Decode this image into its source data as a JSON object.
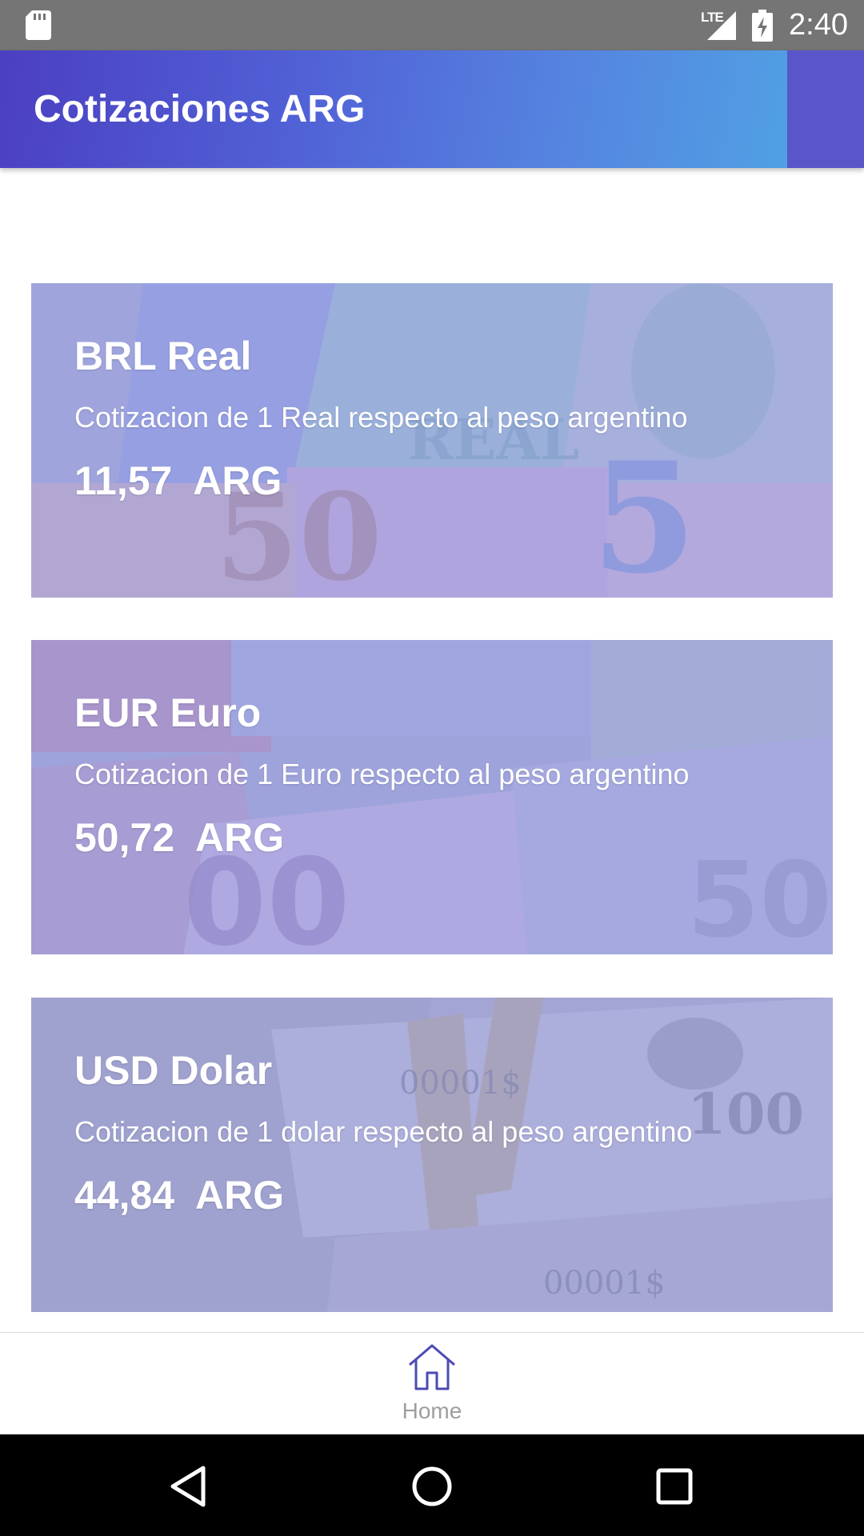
{
  "status_bar": {
    "network": "LTE",
    "time": "2:40",
    "icons": [
      "sd-card-icon",
      "signal-icon",
      "battery-charging-icon"
    ]
  },
  "app_bar": {
    "title": "Cotizaciones ARG"
  },
  "cards": [
    {
      "name": "BRL Real",
      "description": "Cotizacion de 1 Real respecto al peso argentino",
      "price": "11,57  ARG"
    },
    {
      "name": "EUR Euro",
      "description": "Cotizacion de 1 Euro respecto al peso argentino",
      "price": "50,72  ARG"
    },
    {
      "name": "USD Dolar",
      "description": "Cotizacion de 1 dolar respecto al peso argentino",
      "price": "44,84  ARG"
    }
  ],
  "bottom_nav": {
    "items": [
      {
        "label": "Home",
        "icon": "home-icon",
        "active": true
      }
    ]
  },
  "system_nav": {
    "icons": [
      "back-icon",
      "home-circle-icon",
      "recents-icon"
    ]
  },
  "colors": {
    "app_bar_start": "#4b3fc1",
    "app_bar_end": "#4fa7e4",
    "card_tint": "#6c6cd7",
    "accent": "#5a56c9"
  }
}
